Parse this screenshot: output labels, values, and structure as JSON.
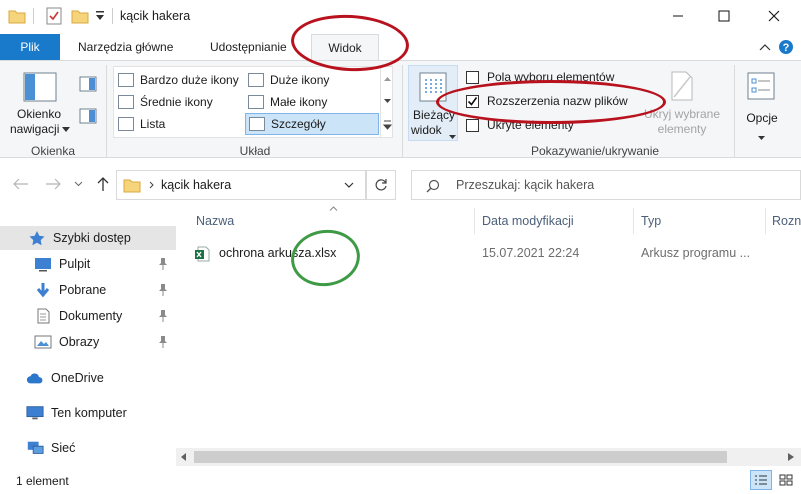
{
  "window": {
    "title": "kącik hakera",
    "controls": {
      "minimize": "—",
      "maximize": "☐",
      "close": "✕"
    },
    "quick_access_toolbar": [
      "folder-icon",
      "properties-checkbox-icon",
      "new-folder-icon",
      "customize-dropdown"
    ]
  },
  "tabs": [
    {
      "label": "Plik",
      "active": false,
      "file_tab": true
    },
    {
      "label": "Narzędzia główne",
      "active": false
    },
    {
      "label": "Udostępnianie",
      "active": false
    },
    {
      "label": "Widok",
      "active": true
    }
  ],
  "ribbon": {
    "groups": {
      "panes": {
        "label": "Okienka",
        "navigation_pane": {
          "line1": "Okienko",
          "line2": "nawigacji"
        }
      },
      "layout": {
        "label": "Układ",
        "options": [
          {
            "label": "Bardzo duże ikony",
            "selected": false
          },
          {
            "label": "Duże ikony",
            "selected": false
          },
          {
            "label": "Średnie ikony",
            "selected": false
          },
          {
            "label": "Małe ikony",
            "selected": false
          },
          {
            "label": "Lista",
            "selected": false
          },
          {
            "label": "Szczegóły",
            "selected": true
          }
        ]
      },
      "current_view": {
        "line1": "Bieżący",
        "line2": "widok"
      },
      "show_hide": {
        "label": "Pokazywanie/ukrywanie",
        "item_checkboxes": {
          "label": "Pola wyboru elementów",
          "checked": false
        },
        "file_extensions": {
          "label": "Rozszerzenia nazw plików",
          "checked": true
        },
        "hidden_items": {
          "label": "Ukryte elementy",
          "checked": false
        },
        "hide_selected": {
          "line1": "Ukryj wybrane",
          "line2": "elementy"
        }
      },
      "options": {
        "label": "Opcje"
      }
    },
    "accent": "#1979ca"
  },
  "address": {
    "path": "kącik hakera",
    "search_placeholder": "Przeszukaj: kącik hakera"
  },
  "nav_pane": {
    "quick_access": {
      "label": "Szybki dostęp"
    },
    "pinned": [
      {
        "label": "Pulpit",
        "icon": "desktop-icon"
      },
      {
        "label": "Pobrane",
        "icon": "downloads-icon"
      },
      {
        "label": "Dokumenty",
        "icon": "documents-icon"
      },
      {
        "label": "Obrazy",
        "icon": "pictures-icon"
      }
    ],
    "onedrive": {
      "label": "OneDrive"
    },
    "this_pc": {
      "label": "Ten komputer"
    },
    "network": {
      "label": "Sieć"
    }
  },
  "file_list": {
    "columns": [
      "Nazwa",
      "Data modyfikacji",
      "Typ",
      "Rozn"
    ],
    "rows": [
      {
        "name": "ochrona arkusza.xlsx",
        "modified": "15.07.2021 22:24",
        "type": "Arkusz programu ..."
      }
    ]
  },
  "status_bar": {
    "count": "1 element"
  },
  "annotations": {
    "red": "#b8121e",
    "green": "#3f9a46"
  }
}
